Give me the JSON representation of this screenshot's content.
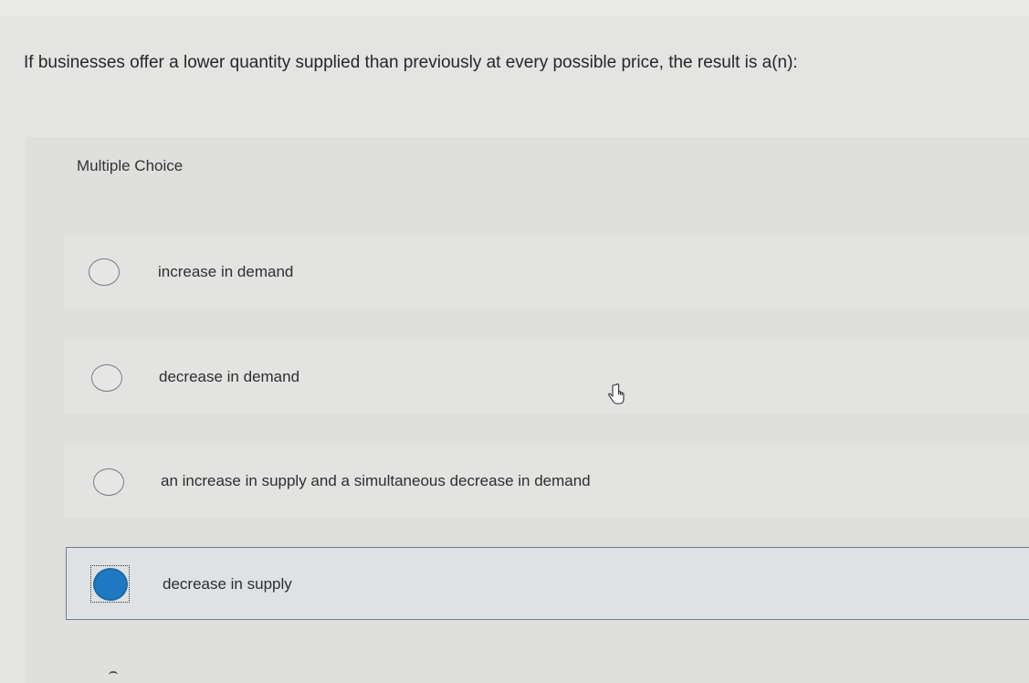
{
  "question": {
    "text": "If businesses offer a lower quantity supplied than previously at every possible price, the result is a(n):"
  },
  "multiple_choice": {
    "label": "Multiple Choice",
    "selected_index": 3,
    "options": [
      {
        "label": "increase in demand",
        "selected": false
      },
      {
        "label": "decrease in demand",
        "selected": false
      },
      {
        "label": "an increase in supply and a simultaneous decrease in demand",
        "selected": false
      },
      {
        "label": "decrease in supply",
        "selected": true
      }
    ]
  },
  "colors": {
    "selected_radio": "#1f78c1",
    "selected_border": "#6a7f8c"
  },
  "icons": {
    "cursor": "hand-pointer-icon"
  }
}
